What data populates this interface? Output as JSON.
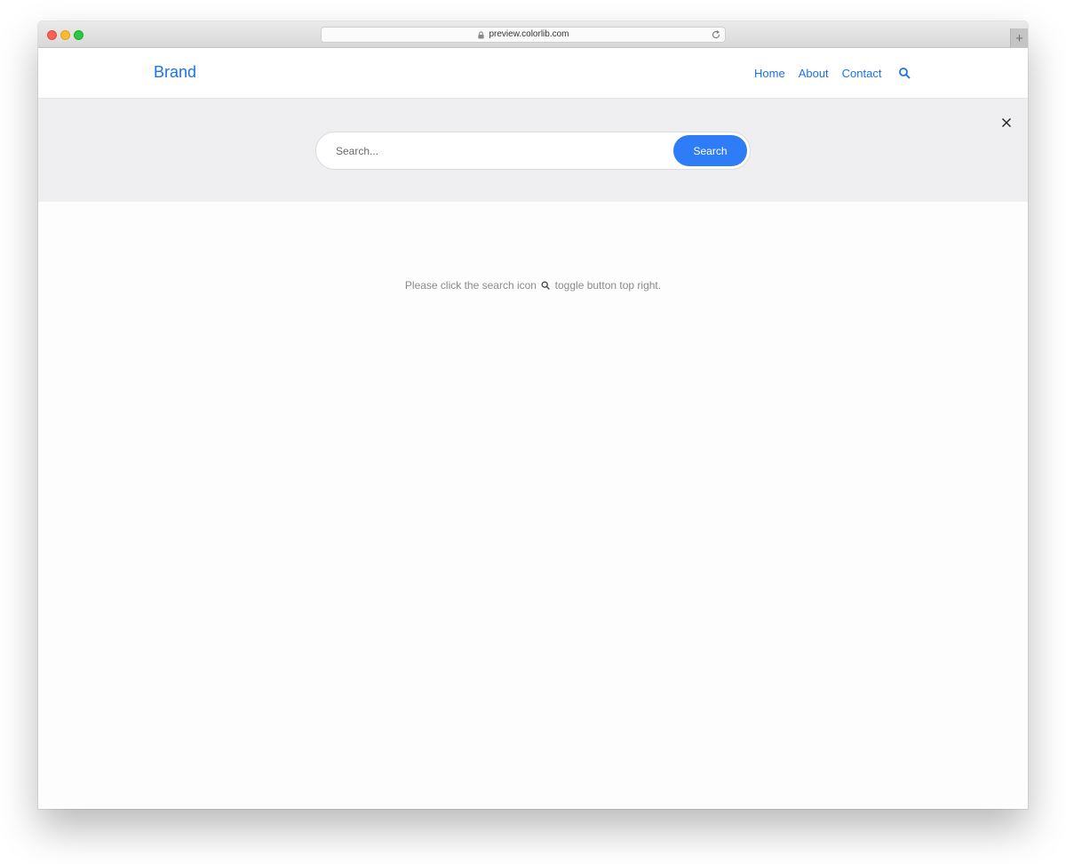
{
  "browser": {
    "url": "preview.colorlib.com",
    "new_tab_symbol": "+"
  },
  "navbar": {
    "brand": "Brand",
    "links": [
      {
        "label": "Home"
      },
      {
        "label": "About"
      },
      {
        "label": "Contact"
      }
    ],
    "search_icon": "search-icon"
  },
  "search_panel": {
    "placeholder": "Search...",
    "button_label": "Search",
    "close_icon": "close-icon"
  },
  "content": {
    "hint_before": "Please click the search icon",
    "hint_after": "toggle button top right."
  },
  "colors": {
    "accent": "#1a73e8",
    "button": "#2e7cf6",
    "panel_bg": "#efeef1"
  }
}
